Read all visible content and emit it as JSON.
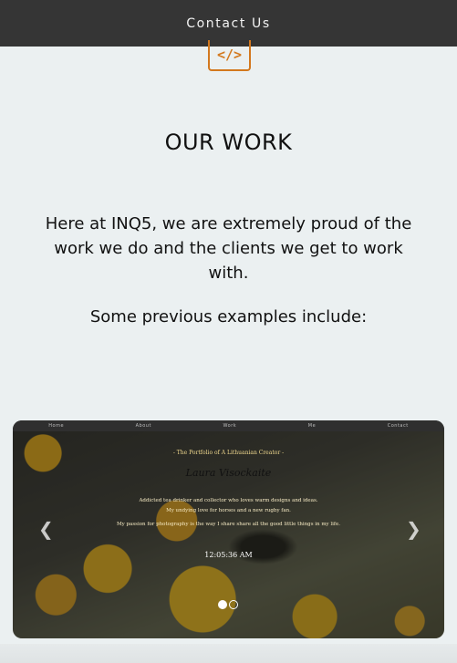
{
  "header": {
    "contact_label": "Contact Us"
  },
  "logo": {
    "icon": "code-icon",
    "glyph": "</>"
  },
  "section": {
    "title": "OUR WORK",
    "intro": "Here at INQ5, we are extremely proud of the work we do and the clients we get to work with.",
    "examples_intro": "Some previous examples include:"
  },
  "preview": {
    "nav": [
      "Home",
      "About",
      "Work",
      "Me",
      "Contact"
    ],
    "subtitle": "- The Portfolio of A Lithuanian Creator -",
    "name": "Laura Visockaite",
    "bio_line1": "Addicted tea drinker and collector who loves warm designs and ideas.",
    "bio_line2": "My undying love for horses and a new rugby fan.",
    "bio_line3": "My passion for photography is the way I share share all the good little things in my life.",
    "clock": "12:05:36 AM",
    "prev_icon": "chevron-left-icon",
    "next_icon": "chevron-right-icon",
    "slides": [
      {
        "active": true
      },
      {
        "active": false
      }
    ]
  },
  "colors": {
    "topbar": "#353535",
    "accent": "#d3781e",
    "page_bg": "#ebf0f1"
  }
}
